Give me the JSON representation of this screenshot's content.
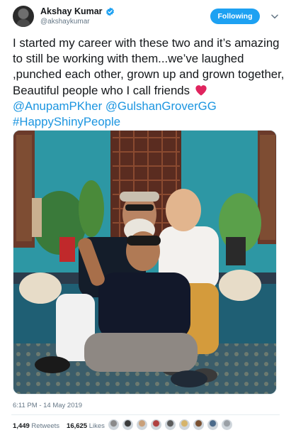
{
  "tweet": {
    "display_name": "Akshay Kumar",
    "handle": "@akshaykumar",
    "follow_label": "Following",
    "text_part1": "I started my career with these two and it’s amazing to still be working with them...we’ve laughed ,punched each other, grown up and grown together, Beautiful people who I call friends",
    "mention1": "@AnupamPKher",
    "mention2": "@GulshanGroverGG",
    "hashtag": "#HappyShinyPeople",
    "timestamp": "6:11 PM - 14 May 2019",
    "retweets_count": "1,449",
    "retweets_label": "Retweets",
    "likes_count": "16,625",
    "likes_label": "Likes"
  },
  "colors": {
    "accent": "#1da1f2",
    "link": "#1b95e0",
    "muted": "#657786",
    "heart": "#e0245e"
  },
  "likers": [
    {
      "icon": "avatar-1",
      "color": "#8a8a8a"
    },
    {
      "icon": "avatar-2",
      "color": "#3a3a3a"
    },
    {
      "icon": "avatar-3",
      "color": "#c9a07a"
    },
    {
      "icon": "avatar-4",
      "color": "#b04040"
    },
    {
      "icon": "avatar-5",
      "color": "#5b5b5b"
    },
    {
      "icon": "avatar-6",
      "color": "#d6b46a"
    },
    {
      "icon": "avatar-7",
      "color": "#7a5030"
    },
    {
      "icon": "avatar-8",
      "color": "#4a6a8a"
    },
    {
      "icon": "avatar-9",
      "color": "#9aa0a6"
    }
  ]
}
